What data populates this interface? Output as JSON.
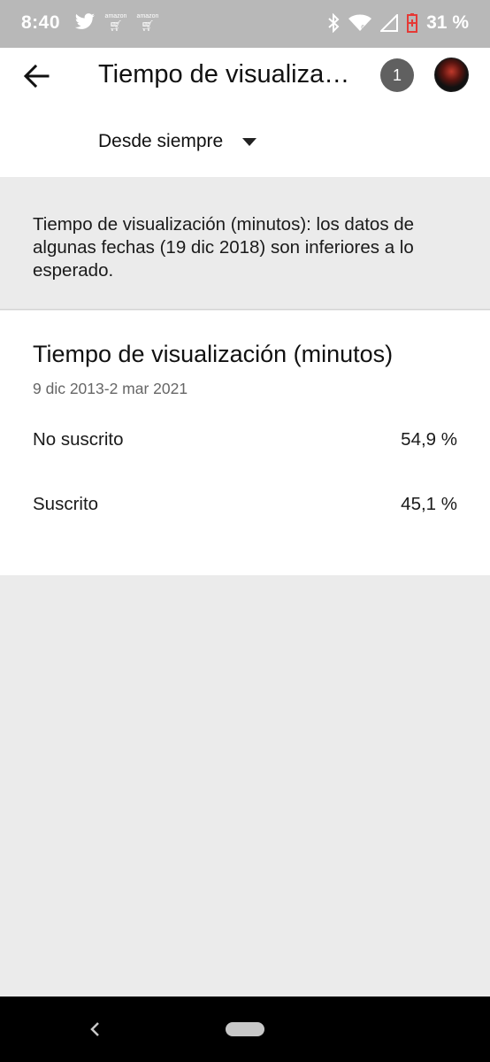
{
  "status_bar": {
    "time": "8:40",
    "left_icons": [
      "twitter-icon",
      "amazon-cart-icon",
      "amazon-cart-icon"
    ],
    "amazon_label": "amazon",
    "right_icons": [
      "bluetooth-icon",
      "wifi-icon",
      "cell-signal-icon",
      "battery-low-icon"
    ],
    "battery": "31 %",
    "colors": {
      "bar": "#b8b8b8",
      "battery_warning": "#e53935"
    }
  },
  "app_bar": {
    "title": "Tiempo de visualización (minutos)",
    "count_badge": "1",
    "back_icon": "arrow-left-icon",
    "avatar": "profile-avatar"
  },
  "range_select": {
    "label": "Desde siempre",
    "icon": "caret-down-icon"
  },
  "notice": {
    "text": "Tiempo de visualización (minutos): los datos de algunas fechas (19 dic 2018) son inferiores a lo esperado."
  },
  "card": {
    "title": "Tiempo de visualización (minutos)",
    "date_range": "9 dic 2013-2 mar 2021",
    "rows": [
      {
        "label": "No suscrito",
        "value": "54,9 %"
      },
      {
        "label": "Suscrito",
        "value": "45,1 %"
      }
    ]
  },
  "nav_bar": {
    "back_icon": "chevron-left-icon",
    "home_icon": "home-pill-icon"
  }
}
